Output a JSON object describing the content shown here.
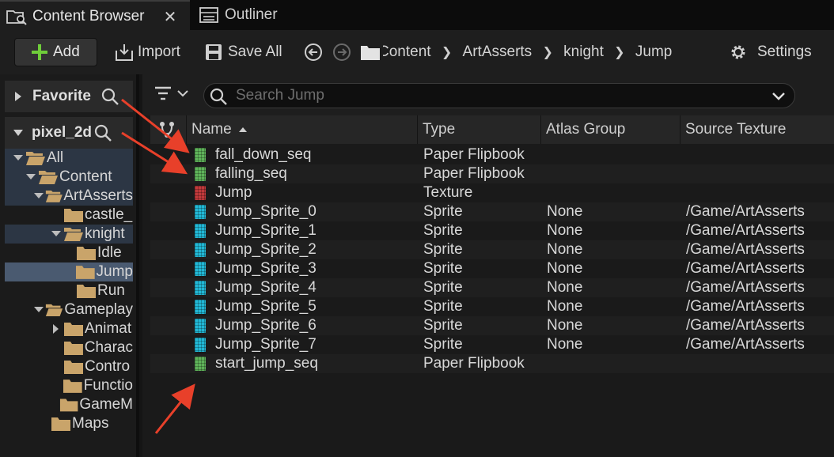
{
  "tabs": [
    {
      "label": "Content Browser",
      "icon": "content-browser-icon",
      "close": "✕"
    },
    {
      "label": "Outliner",
      "icon": "outliner-icon"
    }
  ],
  "toolbar": {
    "add_label": "Add",
    "import_label": "Import",
    "save_all_label": "Save All",
    "settings_label": "Settings",
    "breadcrumbs": [
      "Content",
      "ArtAsserts",
      "knight",
      "Jump"
    ]
  },
  "sidebar": {
    "favorite_label": "Favorite",
    "project_label": "pixel_2d",
    "tree": [
      "All",
      "Content",
      "ArtAsserts",
      "castle_",
      "knight",
      "Idle",
      "Jump",
      "Run",
      "Gameplay",
      "Animat",
      "Charac",
      "Contro",
      "Functio",
      "GameM",
      "Maps"
    ]
  },
  "search": {
    "placeholder": "Search Jump"
  },
  "columns": {
    "name": "Name",
    "type": "Type",
    "atlas": "Atlas Group",
    "source": "Source Texture"
  },
  "assets": [
    {
      "name": "fall_down_seq",
      "type": "Paper Flipbook",
      "atlas": "",
      "source": ""
    },
    {
      "name": "falling_seq",
      "type": "Paper Flipbook",
      "atlas": "",
      "source": ""
    },
    {
      "name": "Jump",
      "type": "Texture",
      "atlas": "",
      "source": ""
    },
    {
      "name": "Jump_Sprite_0",
      "type": "Sprite",
      "atlas": "None",
      "source": "/Game/ArtAsserts"
    },
    {
      "name": "Jump_Sprite_1",
      "type": "Sprite",
      "atlas": "None",
      "source": "/Game/ArtAsserts"
    },
    {
      "name": "Jump_Sprite_2",
      "type": "Sprite",
      "atlas": "None",
      "source": "/Game/ArtAsserts"
    },
    {
      "name": "Jump_Sprite_3",
      "type": "Sprite",
      "atlas": "None",
      "source": "/Game/ArtAsserts"
    },
    {
      "name": "Jump_Sprite_4",
      "type": "Sprite",
      "atlas": "None",
      "source": "/Game/ArtAsserts"
    },
    {
      "name": "Jump_Sprite_5",
      "type": "Sprite",
      "atlas": "None",
      "source": "/Game/ArtAsserts"
    },
    {
      "name": "Jump_Sprite_6",
      "type": "Sprite",
      "atlas": "None",
      "source": "/Game/ArtAsserts"
    },
    {
      "name": "Jump_Sprite_7",
      "type": "Sprite",
      "atlas": "None",
      "source": "/Game/ArtAsserts"
    },
    {
      "name": "start_jump_seq",
      "type": "Paper Flipbook",
      "atlas": "",
      "source": ""
    }
  ],
  "colors": {
    "flipbook": "#5fb35a",
    "texture": "#c0393b",
    "sprite": "#22b8d6",
    "annotation": "#e8402a",
    "add_green": "#6fce3a",
    "folder": "#c9a46a"
  }
}
